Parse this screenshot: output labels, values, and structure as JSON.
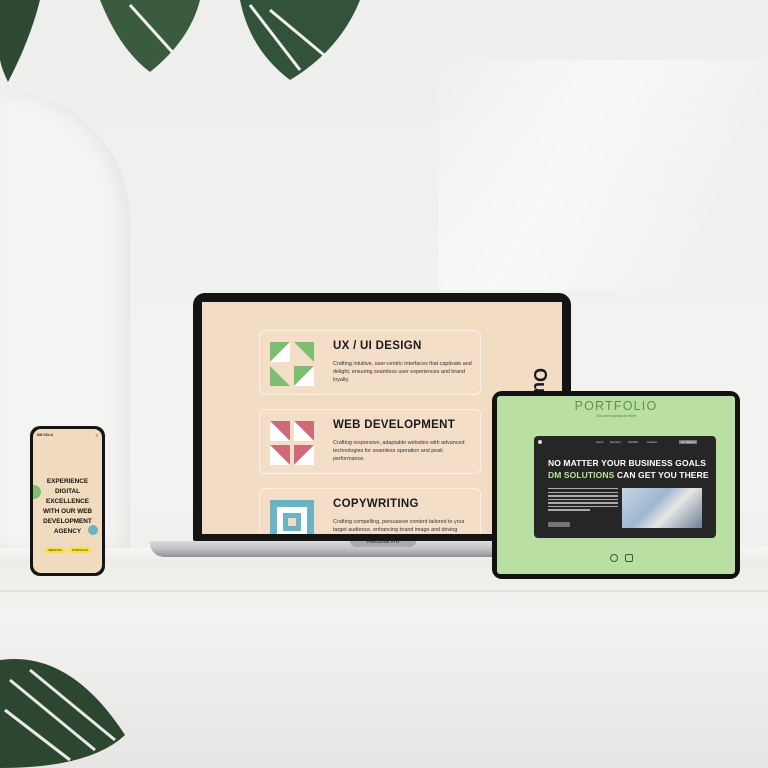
{
  "laptop": {
    "brand": "MacBook Pro",
    "side_text": "Ou",
    "services": [
      {
        "title": "UX / UI DESIGN",
        "desc": "Crafting intuitive, user-centric interfaces that captivate and delight, ensuring seamless user experiences and brand loyalty.",
        "icon": "green-triangles-icon",
        "color": "#7dbf72"
      },
      {
        "title": "WEB DEVELOPMENT",
        "desc": "Crafting responsive, adaptable websites with advanced technologies for seamless operation and peak performance.",
        "icon": "pink-triangles-icon",
        "color": "#cf6b78"
      },
      {
        "title": "COPYWRITING",
        "desc": "Crafting compelling, persuasive content tailored to your target audience, enhancing brand image and driving engagement.",
        "icon": "blue-squares-icon",
        "color": "#6bb4c4"
      }
    ]
  },
  "phone": {
    "brand": "DM SOLU",
    "headline": "EXPERIENCE DIGITAL EXCELLENCE WITH OUR WEB DEVELOPMENT AGENCY",
    "btn1": "SERVICES",
    "btn2": "PORTFOLIO"
  },
  "tablet": {
    "title": "PORTFOLIO",
    "subtitle": "Our work speaks for itself",
    "nav": [
      "Home",
      "Services",
      "Portfolio",
      "Contact",
      "Get Started"
    ],
    "headline1": "NO MATTER YOUR BUSINESS GOALS",
    "headline2_highlight": "DM SOLUTIONS",
    "headline2_rest": " CAN GET YOU THERE"
  },
  "colors": {
    "accent_green": "#b9e0a2",
    "peach": "#f3dcc4",
    "yellow": "#f5e24a"
  }
}
